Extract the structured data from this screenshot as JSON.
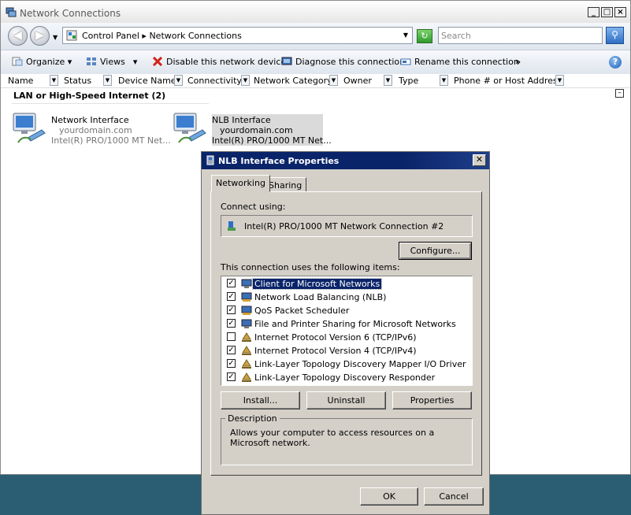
{
  "window": {
    "title": "Network Connections",
    "caption_buttons": [
      "_",
      "□",
      "×"
    ]
  },
  "address": {
    "crumbs": "Control Panel ▸ Network Connections",
    "search_placeholder": "Search"
  },
  "toolbar": {
    "organize": "Organize",
    "views": "Views",
    "disable": "Disable this network device",
    "diagnose": "Diagnose this connection",
    "rename": "Rename this connection",
    "more": "»"
  },
  "columns": [
    "Name",
    "Status",
    "Device Name",
    "Connectivity",
    "Network Category",
    "Owner",
    "Type",
    "Phone # or Host Address"
  ],
  "group": {
    "title": "LAN or High-Speed Internet (2)"
  },
  "connections": [
    {
      "name": "Network Interface",
      "domain": "yourdomain.com",
      "device": "Intel(R) PRO/1000 MT Net..."
    },
    {
      "name": "NLB Interface",
      "domain": "yourdomain.com",
      "device": "Intel(R) PRO/1000 MT Net..."
    }
  ],
  "dialog": {
    "title": "NLB Interface Properties",
    "tabs": [
      "Networking",
      "Sharing"
    ],
    "connect_using_label": "Connect using:",
    "adapter": "Intel(R) PRO/1000 MT Network Connection #2",
    "configure": "Configure...",
    "items_label": "This connection uses the following items:",
    "items": [
      {
        "label": "Client for Microsoft Networks",
        "checked": true
      },
      {
        "label": "Network Load Balancing (NLB)",
        "checked": true
      },
      {
        "label": "QoS Packet Scheduler",
        "checked": true
      },
      {
        "label": "File and Printer Sharing for Microsoft Networks",
        "checked": true
      },
      {
        "label": "Internet Protocol Version 6 (TCP/IPv6)",
        "checked": false
      },
      {
        "label": "Internet Protocol Version 4 (TCP/IPv4)",
        "checked": true
      },
      {
        "label": "Link-Layer Topology Discovery Mapper I/O Driver",
        "checked": true
      },
      {
        "label": "Link-Layer Topology Discovery Responder",
        "checked": true
      }
    ],
    "install": "Install...",
    "uninstall": "Uninstall",
    "properties": "Properties",
    "description_label": "Description",
    "description": "Allows your computer to access resources on a Microsoft network.",
    "ok": "OK",
    "cancel": "Cancel"
  }
}
